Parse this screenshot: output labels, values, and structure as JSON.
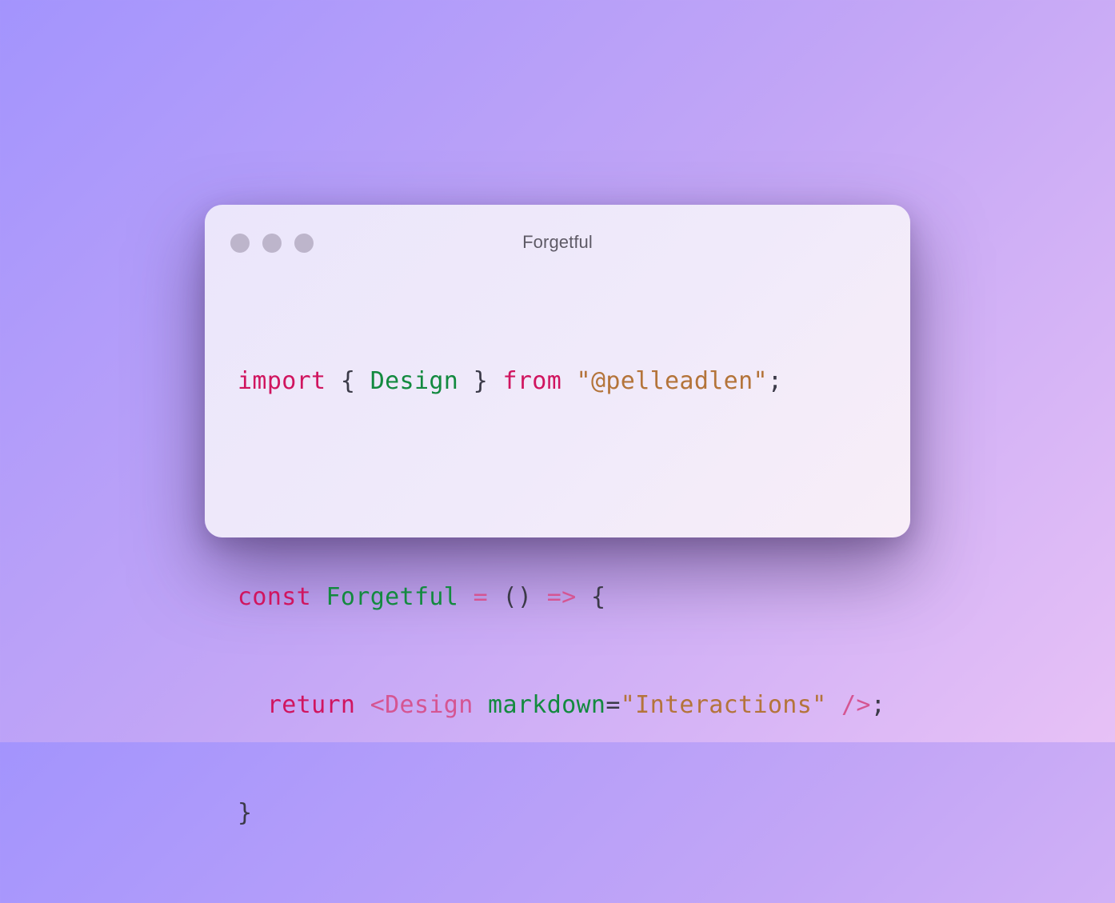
{
  "window": {
    "title": "Forgetful"
  },
  "code": {
    "line1": {
      "import_kw": "import",
      "brace_open": " { ",
      "name": "Design",
      "brace_close": " } ",
      "from_kw": "from",
      "space": " ",
      "module": "\"@pelleadlen\"",
      "semi": ";"
    },
    "line2": {
      "const_kw": "const",
      "space1": " ",
      "component": "Forgetful",
      "space2": " ",
      "equals": "=",
      "parens": " () ",
      "arrow": "=>",
      "brace": " {"
    },
    "line3": {
      "indent": "  ",
      "return_kw": "return",
      "space1": " ",
      "tag_open": "<Design",
      "space2": " ",
      "attr": "markdown",
      "eq": "=",
      "attr_value": "\"Interactions\"",
      "space3": " ",
      "tag_close": "/>",
      "semi": ";"
    },
    "line4": {
      "brace": "}"
    }
  },
  "colors": {
    "keyword": "#d0155f",
    "identifier": "#138a3f",
    "string": "#b4743a",
    "operator": "#d55592",
    "punctuation": "#3b3a48"
  },
  "icons": [
    "window-close-dot",
    "window-minimize-dot",
    "window-zoom-dot"
  ]
}
